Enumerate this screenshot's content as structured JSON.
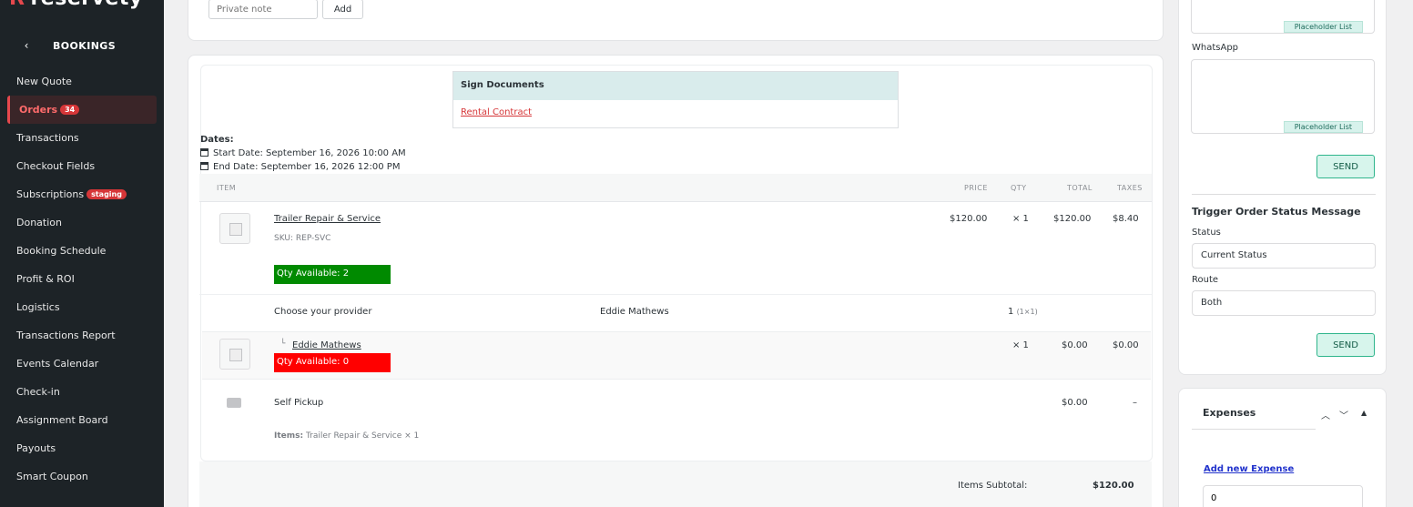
{
  "brand": {
    "name": "reservety",
    "logo_mark": "R"
  },
  "sidebar": {
    "back_icon": "chevron-left-icon",
    "title": "BOOKINGS",
    "items": [
      {
        "label": "New Quote"
      },
      {
        "label": "Orders",
        "badge": "34",
        "active": true
      },
      {
        "label": "Transactions"
      },
      {
        "label": "Checkout Fields"
      },
      {
        "label": "Subscriptions",
        "badge": "staging"
      },
      {
        "label": "Donation"
      },
      {
        "label": "Booking Schedule"
      },
      {
        "label": "Profit & ROI"
      },
      {
        "label": "Logistics"
      },
      {
        "label": "Transactions Report"
      },
      {
        "label": "Events Calendar"
      },
      {
        "label": "Check-in"
      },
      {
        "label": "Assignment Board"
      },
      {
        "label": "Payouts"
      },
      {
        "label": "Smart Coupon"
      }
    ]
  },
  "note": {
    "placeholder": "Private note",
    "add_label": "Add"
  },
  "documents": {
    "header": "Sign Documents",
    "link": "Rental Contract"
  },
  "dates": {
    "label": "Dates:",
    "start": "Start Date: September 16, 2026 10:00 AM",
    "end": "End Date: September 16, 2026 12:00 PM"
  },
  "table": {
    "headers": {
      "item": "ITEM",
      "price": "PRICE",
      "qty": "QTY",
      "total": "TOTAL",
      "taxes": "TAXES"
    },
    "product": {
      "name": "Trailer Repair & Service",
      "sku_label": "SKU:",
      "sku": "REP-SVC",
      "price": "$120.00",
      "qty": "× 1",
      "total": "$120.00",
      "taxes": "$8.40",
      "availability": "Qty Available: 2"
    },
    "provider": {
      "label": "Choose your provider",
      "value": "Eddie Mathews",
      "qty": "1",
      "qty_detail": "(1×1)"
    },
    "child": {
      "prefix": "└",
      "name": "Eddie Mathews",
      "qty": "× 1",
      "total": "$0.00",
      "taxes": "$0.00",
      "availability": "Qty Available: 0"
    },
    "shipping": {
      "label": "Self Pickup",
      "total": "$0.00",
      "taxes": "–",
      "items_label": "Items:",
      "items": "Trailer Repair & Service × 1"
    }
  },
  "summary": {
    "subtotal_label": "Items Subtotal:",
    "subtotal": "$120.00"
  },
  "messaging": {
    "placeholder_list_label": "Placeholder List",
    "whatsapp_label": "WhatsApp",
    "send_label": "SEND",
    "trigger_title": "Trigger Order Status Message",
    "status_label": "Status",
    "status_value": "Current Status",
    "route_label": "Route",
    "route_value": "Both"
  },
  "expenses": {
    "title": "Expenses",
    "add_link": "Add new Expense",
    "input_value": "0"
  },
  "colors": {
    "sidebar_bg": "#1d2327",
    "accent_red": "#e5484d",
    "available_green": "#008a00",
    "unavailable_red": "#ff0000",
    "send_green": "#2fb58c"
  }
}
